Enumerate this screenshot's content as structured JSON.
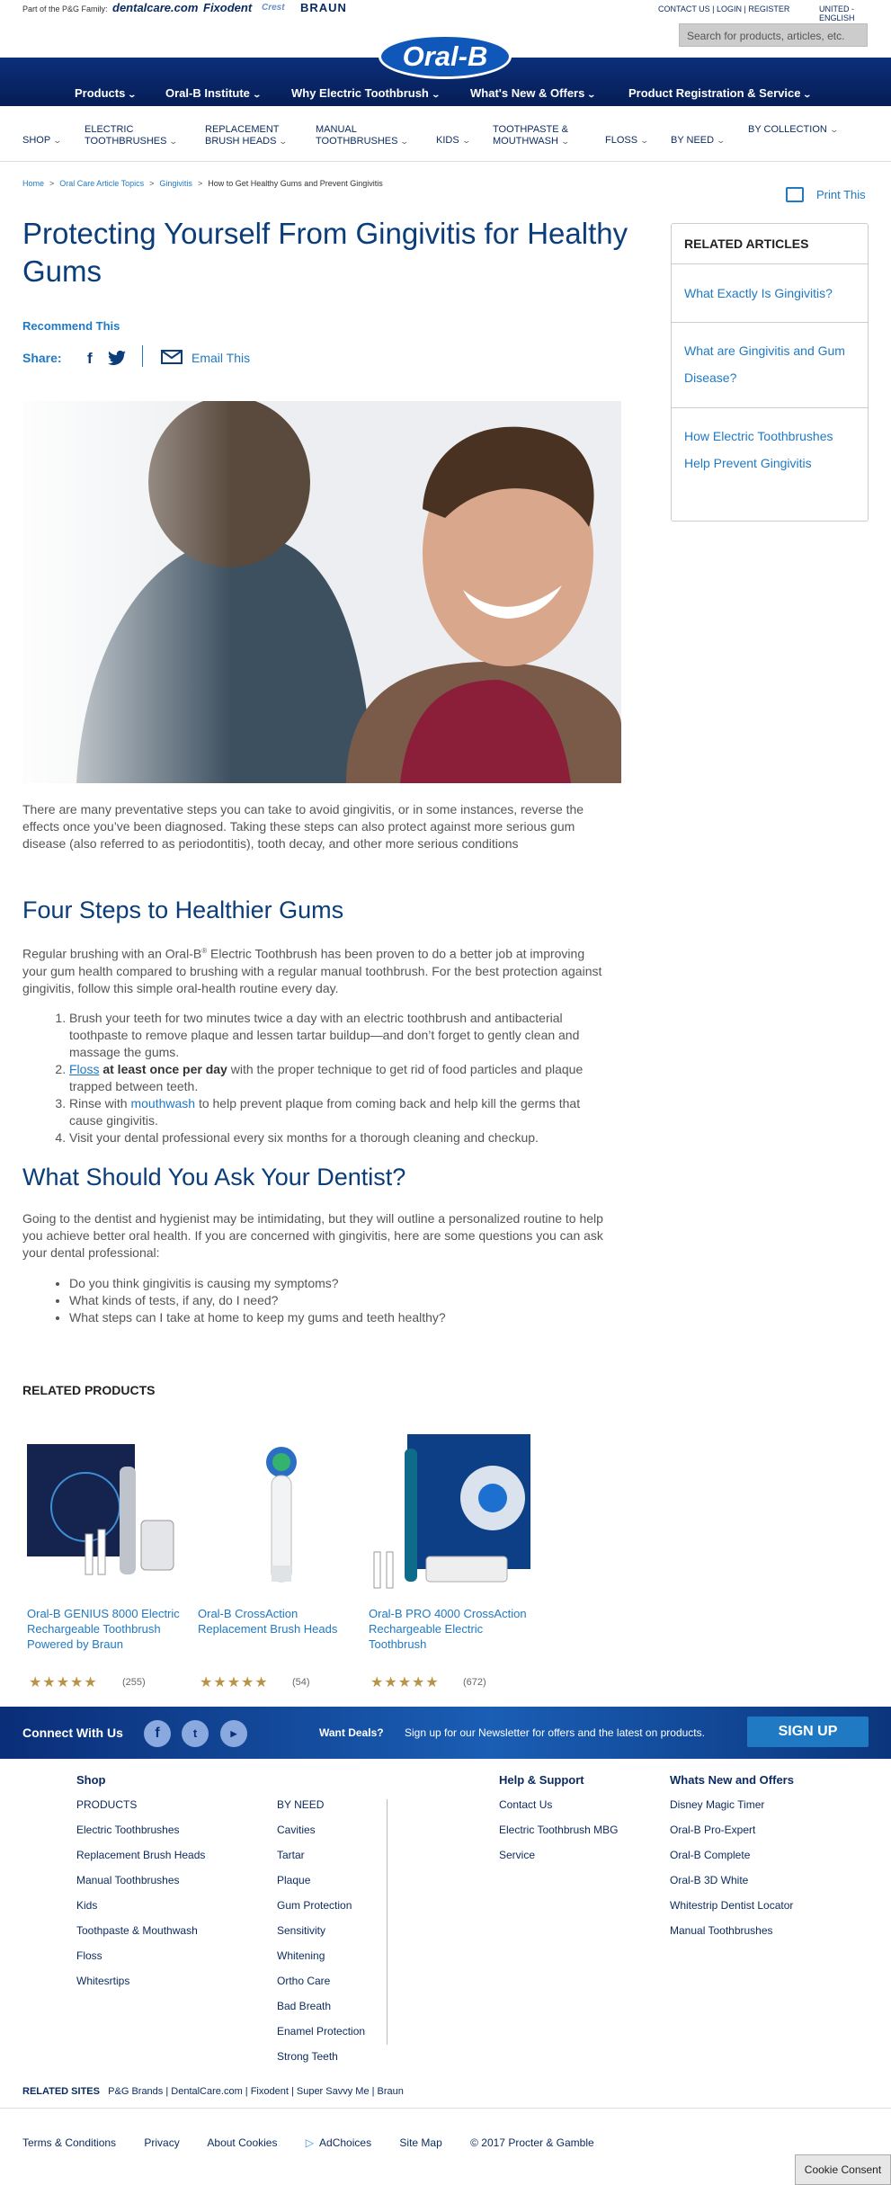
{
  "topbar": {
    "pg_family_label": "Part of the P&G Family:",
    "brands": [
      "dentalcare.com",
      "Fixodent",
      "Crest",
      "BRAUN"
    ],
    "util_links": "CONTACT US | LOGIN | REGISTER",
    "region": "UNITED - ENGLISH",
    "search_placeholder": "Search for products, articles, etc."
  },
  "logo": "Oral-B",
  "main_nav": [
    "Products",
    "Oral-B Institute",
    "Why Electric Toothbrush",
    "What's New & Offers",
    "Product Registration & Service"
  ],
  "sub_nav": [
    "SHOP",
    "ELECTRIC TOOTHBRUSHES",
    "REPLACEMENT BRUSH HEADS",
    "MANUAL TOOTHBRUSHES",
    "KIDS",
    "TOOTHPASTE & MOUTHWASH",
    "FLOSS",
    "BY NEED",
    "BY COLLECTION"
  ],
  "breadcrumb": [
    "Home",
    "Oral Care Article Topics",
    "Gingivitis",
    "How to Get Healthy Gums and Prevent Gingivitis"
  ],
  "print_label": "Print This",
  "article": {
    "title": "Protecting Yourself From Gingivitis for Healthy Gums",
    "recommend": "Recommend This",
    "share_label": "Share:",
    "email_label": "Email This",
    "intro": "There are many preventative steps you can take to avoid gingivitis, or in some instances, reverse the effects once you’ve been diagnosed. Taking these steps can also protect against more serious gum disease (also referred to as periodontitis), tooth decay, and other more serious conditions",
    "h2_steps": "Four Steps to Healthier Gums",
    "steps_intro_a": "Regular brushing with an Oral-B",
    "steps_intro_b": " Electric Toothbrush has been proven to do a better job at improving your gum health compared to brushing with a regular manual toothbrush. For the best protection against gingivitis, follow this simple oral-health routine every day.",
    "step1": "Brush your teeth for two minutes twice a day with an electric toothbrush and antibacterial toothpaste to remove plaque and lessen tartar buildup—and don’t forget to gently clean and massage the gums.",
    "step2_link": "Floss",
    "step2_bold": " at least once per day",
    "step2_rest": " with the proper technique to get rid of food particles and plaque trapped between teeth.",
    "step3_a": "Rinse with ",
    "step3_link": "mouthwash",
    "step3_b": " to help prevent plaque from coming back and help kill the germs that cause gingivitis.",
    "step4": "Visit your dental professional every six months for a thorough cleaning and checkup.",
    "h2_dentist": "What Should You Ask Your Dentist?",
    "dentist_intro": "Going to the dentist and hygienist may be intimidating, but they will outline a personalized routine to help you achieve better oral health. If you are concerned with gingivitis, here are some questions you can ask your dental professional:",
    "questions": [
      "Do you think gingivitis is causing my symptoms?",
      "What kinds of tests, if any, do I need?",
      "What steps can I take at home to keep my gums and teeth healthy?"
    ]
  },
  "related_articles": {
    "title": "RELATED ARTICLES",
    "items": [
      "What Exactly Is Gingivitis?",
      "What are Gingivitis and Gum Disease?",
      "How Electric Toothbrushes Help Prevent Gingivitis"
    ]
  },
  "related_products": {
    "title": "RELATED PRODUCTS",
    "items": [
      {
        "name": "Oral-B GENIUS 8000 Electric Rechargeable Toothbrush Powered by Braun",
        "rating": 5,
        "stars": "★★★★★",
        "count": "(255)"
      },
      {
        "name": "Oral-B CrossAction Replacement Brush Heads",
        "rating": 5,
        "stars": "★★★★★",
        "count": "(54)"
      },
      {
        "name": "Oral-B PRO 4000 CrossAction Rechargeable Electric Toothbrush",
        "rating": 5,
        "stars": "★★★★★",
        "count": "(672)"
      }
    ]
  },
  "connect": {
    "label": "Connect With Us",
    "deals": "Want Deals?",
    "text": "Sign up for our Newsletter for offers and the latest on products.",
    "button": "SIGN UP"
  },
  "footer": {
    "shop_title": "Shop",
    "shop_col1": [
      "PRODUCTS",
      "Electric Toothbrushes",
      "Replacement Brush Heads",
      "Manual Toothbrushes",
      "Kids",
      "Toothpaste & Mouthwash",
      "Floss",
      "Whitesrtips"
    ],
    "shop_col2": [
      "BY NEED",
      "Cavities",
      "Tartar",
      "Plaque",
      "Gum Protection",
      "Sensitivity",
      "Whitening",
      "Ortho Care",
      "Bad Breath",
      "Enamel Protection",
      "Strong Teeth"
    ],
    "help_title": "Help & Support",
    "help_items": [
      "Contact Us",
      "Electric Toothbrush MBG",
      "Service"
    ],
    "new_title": "Whats New and Offers",
    "new_items": [
      "Disney Magic Timer",
      "Oral-B Pro-Expert",
      "Oral-B Complete",
      "Oral-B 3D White",
      "Whitestrip Dentist Locator",
      "Manual Toothbrushes"
    ],
    "related_sites_label": "RELATED SITES",
    "related_sites": "P&G Brands  |  DentalCare.com  |  Fixodent  |  Super Savvy Me  |  Braun",
    "bottom_links": [
      "Terms & Conditions",
      "Privacy",
      "About Cookies",
      "AdChoices",
      "Site Map",
      "© 2017 Procter & Gamble"
    ],
    "cookie": "Cookie Consent"
  }
}
